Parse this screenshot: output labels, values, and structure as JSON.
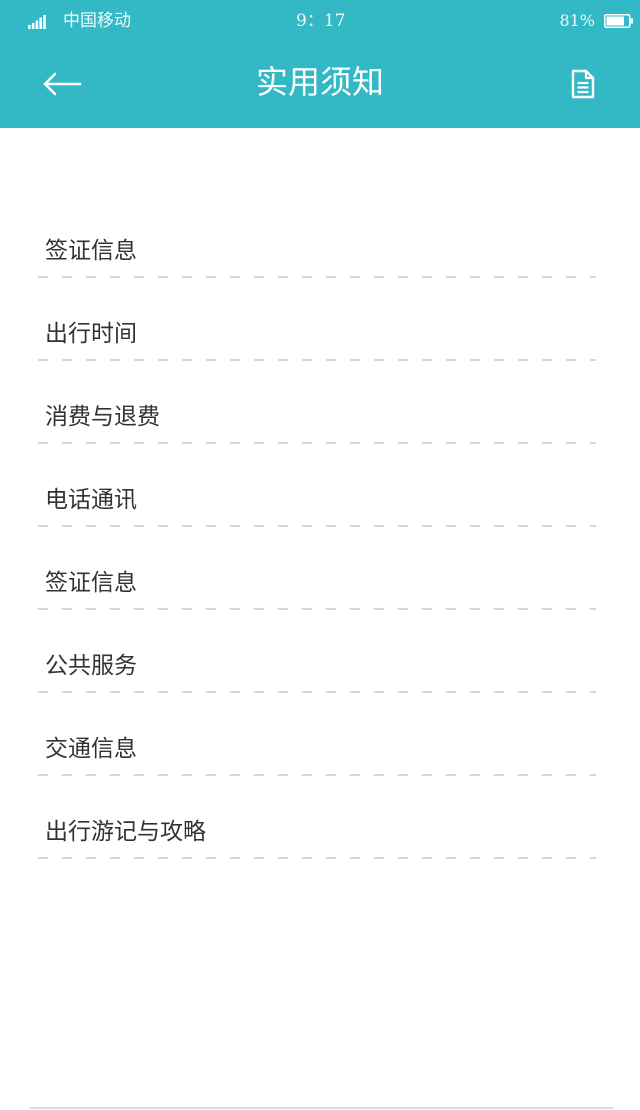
{
  "status_bar": {
    "carrier": "中国移动",
    "time": "9：17",
    "battery": "81%"
  },
  "header": {
    "title": "实用须知",
    "back_icon": "back-arrow-icon",
    "action_icon": "document-icon"
  },
  "items": [
    {
      "label": "签证信息"
    },
    {
      "label": "出行时间"
    },
    {
      "label": "消费与退费"
    },
    {
      "label": "电话通讯"
    },
    {
      "label": "签证信息"
    },
    {
      "label": "公共服务"
    },
    {
      "label": "交通信息"
    },
    {
      "label": "出行游记与攻略"
    }
  ],
  "colors": {
    "header": "#33b9c5",
    "text": "#333333",
    "divider": "#c8c8c8",
    "background": "#ffffff"
  }
}
